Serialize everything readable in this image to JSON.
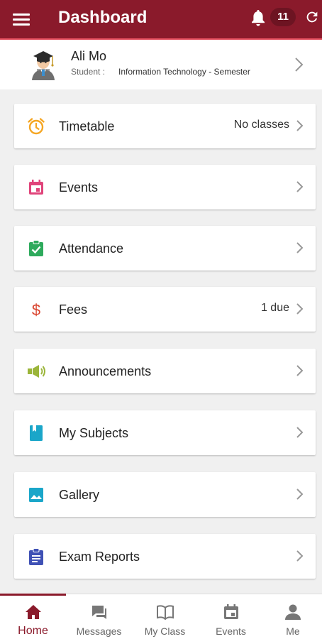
{
  "appbar": {
    "title": "Dashboard",
    "notification_count": "11",
    "menu_icon": "menu-icon",
    "bell_icon": "bell-icon",
    "refresh_icon": "refresh-icon"
  },
  "profile": {
    "name": "Ali Mo",
    "role": "Student :",
    "program": "Information Technology - Semester"
  },
  "cards": [
    {
      "label": "Timetable",
      "value": "No classes",
      "icon": "alarm-clock-icon",
      "color": "#f5a623"
    },
    {
      "label": "Events",
      "value": "",
      "icon": "calendar-icon",
      "color": "#e0447a"
    },
    {
      "label": "Attendance",
      "value": "",
      "icon": "clipboard-check-icon",
      "color": "#2eaa5c"
    },
    {
      "label": "Fees",
      "value": "1 due",
      "icon": "dollar-icon",
      "color": "#d9442e"
    },
    {
      "label": "Announcements",
      "value": "",
      "icon": "megaphone-icon",
      "color": "#9bb53a"
    },
    {
      "label": "My Subjects",
      "value": "",
      "icon": "book-icon",
      "color": "#1aa6c9"
    },
    {
      "label": "Gallery",
      "value": "",
      "icon": "image-icon",
      "color": "#1aa6c9"
    },
    {
      "label": "Exam Reports",
      "value": "",
      "icon": "report-icon",
      "color": "#3f51b5"
    }
  ],
  "bottom_nav": [
    {
      "label": "Home",
      "icon": "home-icon",
      "active": true
    },
    {
      "label": "Messages",
      "icon": "chat-icon",
      "active": false
    },
    {
      "label": "My Class",
      "icon": "open-book-icon",
      "active": false
    },
    {
      "label": "Events",
      "icon": "calendar-icon",
      "active": false
    },
    {
      "label": "Me",
      "icon": "person-icon",
      "active": false
    }
  ],
  "colors": {
    "primary": "#8a1a2b",
    "accent_line": "#e44c5c",
    "background": "#f0f0f0",
    "nav_inactive": "#666666"
  }
}
